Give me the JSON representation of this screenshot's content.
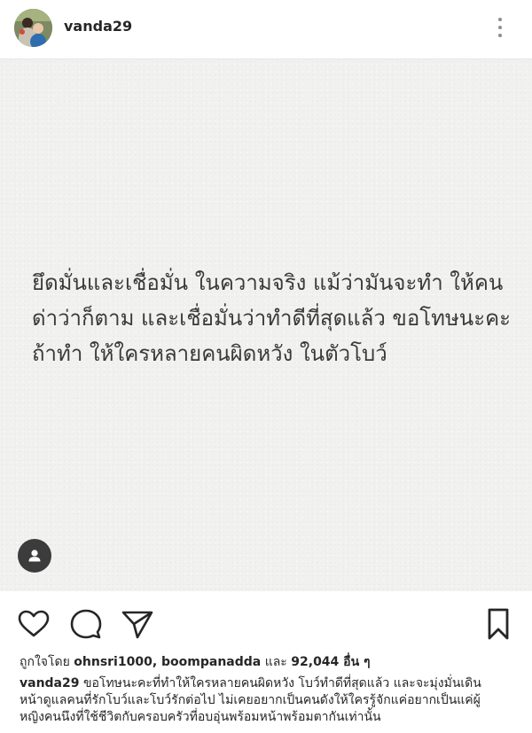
{
  "header": {
    "username": "vanda29",
    "avatar_icon": "profile-photo",
    "more_icon": "more-options-icon"
  },
  "post": {
    "text_lines": [
      "ยึดมั่นและเชื่อมั่น ในความจริง แม้ว่ามันจะทำ ให้คน",
      "ด่าว่าก็ตาม และเชื่อมั่นว่าทำดีที่สุดแล้ว ขอโทษนะคะ",
      "ถ้าทำ ให้ใครหลายคนผิดหวัง ในตัวโบว์"
    ],
    "tag_icon": "user-tag-icon"
  },
  "actions": {
    "like_icon": "heart-icon",
    "comment_icon": "comment-icon",
    "share_icon": "share-icon",
    "save_icon": "bookmark-icon"
  },
  "likes": {
    "prefix": "ถูกใจโดย",
    "users": "ohnsri1000, boompanadda",
    "conjunction": "และ",
    "count": "92,044 อื่น ๆ"
  },
  "caption": {
    "username": "vanda29",
    "line1": " ขอโทษนะคะที่ทำให้ใครหลายคนผิดหวัง โบว์ทำดีที่สุดแล้ว และจะมุ่งมั่นเดิน",
    "line2": "หน้าดูแลคนที่รักโบว์และโบว์รักต่อไป ไม่เคยอยากเป็นคนดังให้ใครรู้จักแค่อยากเป็นแค่ผู้",
    "line3": "หญิงคนนึงที่ใช้ชีวิตกับครอบครัวที่อบอุ่นพร้อมหน้าพร้อมตากันเท่านั้น"
  },
  "colors": {
    "text": "#262626",
    "secondary": "#8e8e8e",
    "post_background": "#f1f1f0",
    "tag_button": "#3c3c3c"
  }
}
